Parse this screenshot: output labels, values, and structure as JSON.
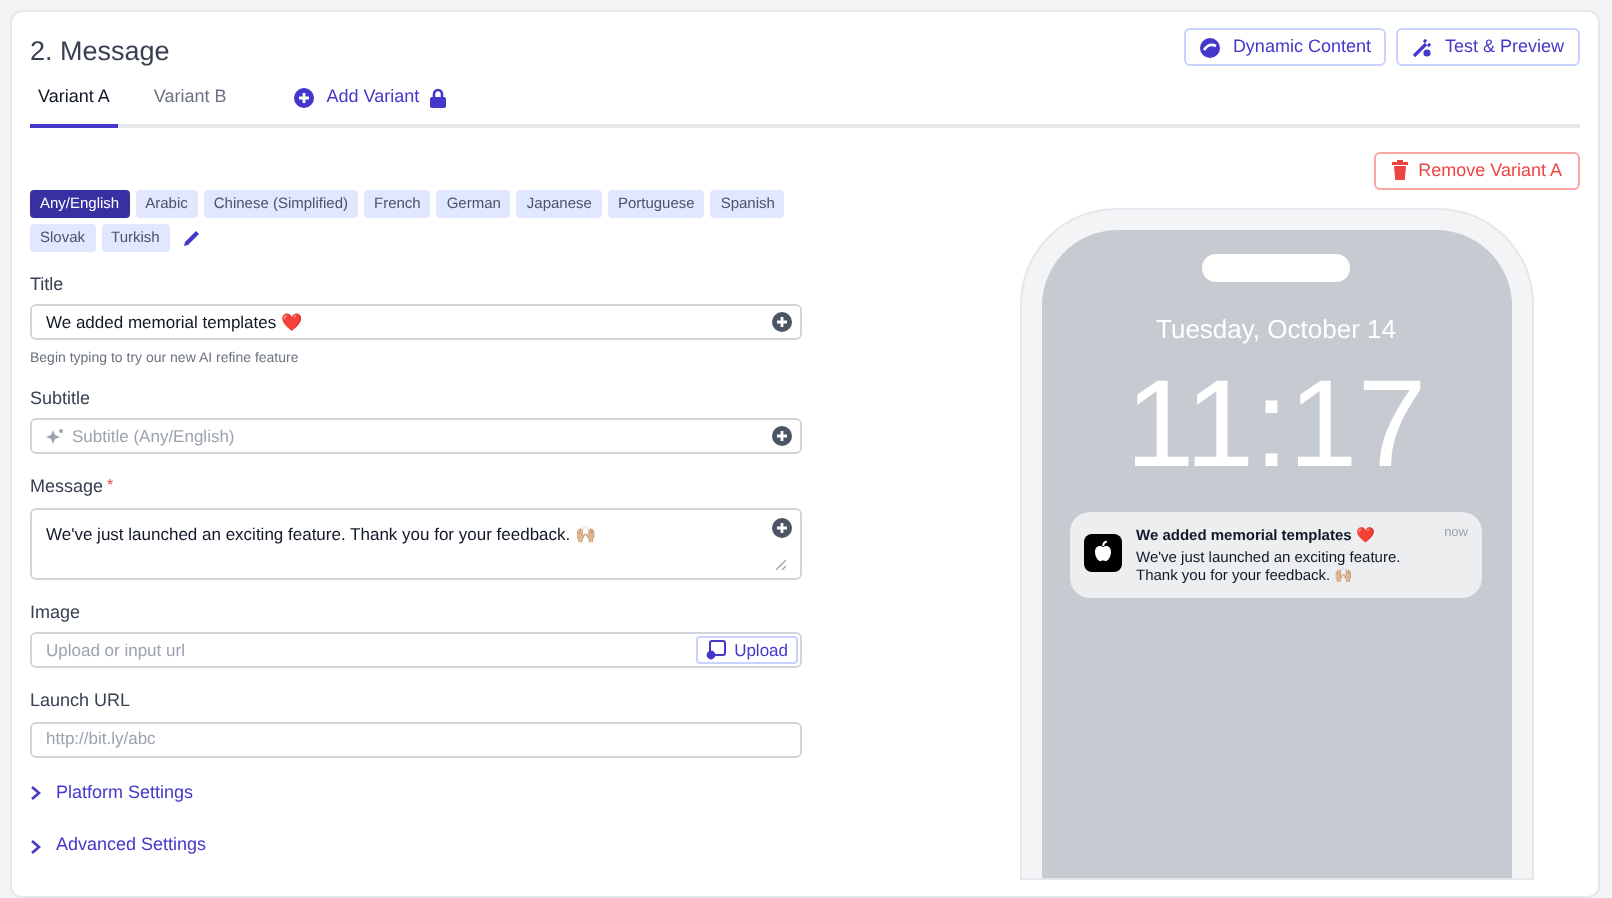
{
  "section_title": "2. Message",
  "header_buttons": [
    {
      "kind": "dynamic",
      "label": "Dynamic Content"
    },
    {
      "kind": "test",
      "label": "Test & Preview"
    }
  ],
  "tabs": [
    {
      "label": "Variant A",
      "selected": true
    },
    {
      "label": "Variant B",
      "selected": false
    }
  ],
  "add_variant": {
    "label": "Add Variant",
    "locked": true
  },
  "remove_button": "Remove Variant A",
  "languages": [
    {
      "label": "Any/English",
      "selected": true
    },
    {
      "label": "Arabic",
      "selected": false
    },
    {
      "label": "Chinese (Simplified)",
      "selected": false
    },
    {
      "label": "French",
      "selected": false
    },
    {
      "label": "German",
      "selected": false
    },
    {
      "label": "Japanese",
      "selected": false
    },
    {
      "label": "Portuguese",
      "selected": false
    },
    {
      "label": "Spanish",
      "selected": false
    },
    {
      "label": "Slovak",
      "selected": false
    },
    {
      "label": "Turkish",
      "selected": false
    }
  ],
  "fields": [
    {
      "kind": "input",
      "label": "Title",
      "value": "We added memorial templates ❤️",
      "hint": "Begin typing to try our new AI refine feature"
    },
    {
      "kind": "ai_input",
      "label": "Subtitle",
      "placeholder": "Subtitle (Any/English)"
    },
    {
      "kind": "textarea",
      "label": "Message",
      "required_mark": "*",
      "value": "We've just launched an exciting feature. Thank you for your feedback. 🙌🏼"
    },
    {
      "kind": "upload",
      "label": "Image",
      "placeholder": "Upload or input url",
      "button": "Upload"
    },
    {
      "kind": "plain",
      "label": "Launch URL",
      "placeholder": "http://bit.ly/abc"
    }
  ],
  "collapsibles": [
    {
      "label": "Platform Settings",
      "expanded": false
    },
    {
      "label": "Advanced Settings",
      "expanded": false
    }
  ],
  "preview": {
    "date": "Tuesday, October 14",
    "time": "11:17",
    "notification": {
      "title": "We added memorial templates ❤️",
      "body": "We've just launched an exciting feature. Thank you for your feedback. 🙌🏼",
      "age": "now"
    }
  }
}
